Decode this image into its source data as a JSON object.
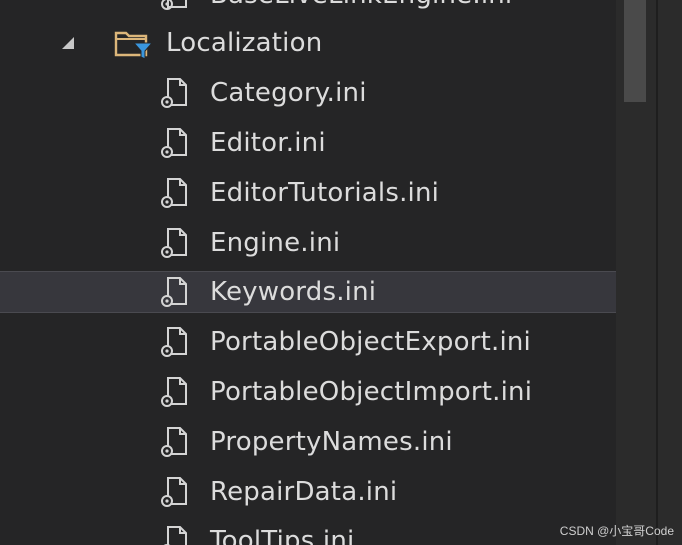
{
  "tree": {
    "partial_top_item": "BaseLiveLinkEngine.ini",
    "folder": {
      "label": "Localization",
      "expanded": true,
      "icon": "filtered-folder-icon"
    },
    "files": [
      {
        "label": "Category.ini",
        "icon": "config-file-icon"
      },
      {
        "label": "Editor.ini",
        "icon": "config-file-icon"
      },
      {
        "label": "EditorTutorials.ini",
        "icon": "config-file-icon"
      },
      {
        "label": "Engine.ini",
        "icon": "config-file-icon"
      },
      {
        "label": "Keywords.ini",
        "icon": "config-file-icon",
        "selected": true
      },
      {
        "label": "PortableObjectExport.ini",
        "icon": "config-file-icon"
      },
      {
        "label": "PortableObjectImport.ini",
        "icon": "config-file-icon"
      },
      {
        "label": "PropertyNames.ini",
        "icon": "config-file-icon"
      },
      {
        "label": "RepairData.ini",
        "icon": "config-file-icon"
      },
      {
        "label": "ToolTips.ini",
        "icon": "config-file-icon"
      }
    ]
  },
  "watermark": "CSDN @小宝哥Code",
  "colors": {
    "background": "#252526",
    "selection": "#37373d",
    "text": "#dcdcdc",
    "folder_yellow": "#dcb67a",
    "filter_blue": "#3a96dd",
    "scrollbar_thumb": "#4a4a4a"
  }
}
